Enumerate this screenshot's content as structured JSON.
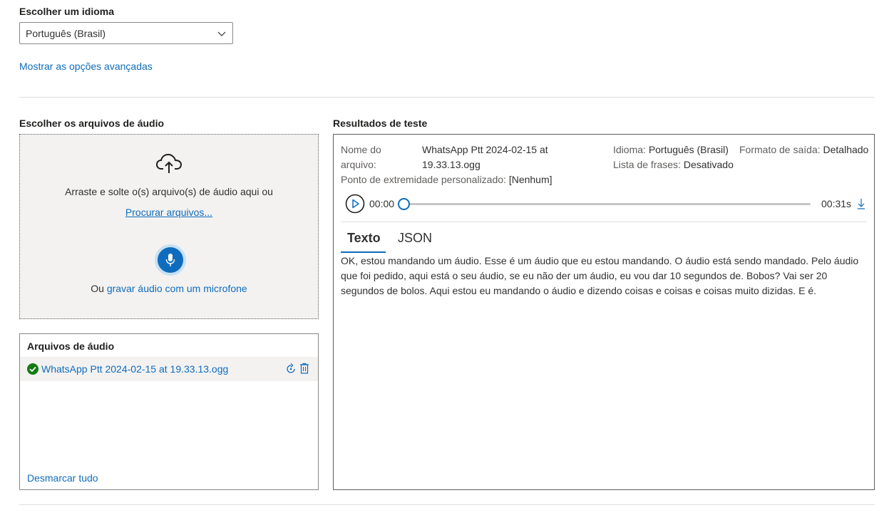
{
  "language": {
    "label": "Escolher um idioma",
    "selected": "Português (Brasil)",
    "advanced_link": "Mostrar as opções avançadas"
  },
  "upload": {
    "title": "Escolher os arquivos de áudio",
    "drop_text": "Arraste e solte o(s) arquivo(s) de áudio aqui ou",
    "browse_link": "Procurar arquivos...",
    "record_prefix": "Ou ",
    "record_link": "gravar áudio com um microfone"
  },
  "files": {
    "title": "Arquivos de áudio",
    "items": [
      {
        "name": "WhatsApp Ptt 2024-02-15 at 19.33.13.ogg",
        "status": "success"
      }
    ],
    "deselect_all": "Desmarcar tudo"
  },
  "results": {
    "title": "Resultados de teste",
    "file_name_label_1": "Nome do",
    "file_name_label_2": "arquivo:",
    "file_name_value_1": "WhatsApp Ptt 2024-02-15 at",
    "file_name_value_2": "19.33.13.ogg",
    "language_label": "Idioma:",
    "language_value": "Português (Brasil)",
    "output_format_label": "Formato de saída:",
    "output_format_value": "Detalhado",
    "phrase_list_label": "Lista de frases:",
    "phrase_list_value": "Desativado",
    "endpoint_label": "Ponto de extremidade personalizado:",
    "endpoint_value": "[Nenhum]",
    "player": {
      "current_time": "00:00",
      "duration": "00:31s",
      "progress": 0
    },
    "tabs": [
      {
        "label": "Texto",
        "active": true
      },
      {
        "label": "JSON",
        "active": false
      }
    ],
    "transcript": "OK, estou mandando um áudio. Esse é um áudio que eu estou mandando. O áudio está sendo mandado. Pelo áudio que foi pedido, aqui está o seu áudio, se eu não der um áudio, eu vou dar 10 segundos de. Bobos? Vai ser 20 segundos de bolos. Aqui estou eu mandando o áudio e dizendo coisas e coisas e coisas muito dizidas. E é."
  },
  "colors": {
    "accent": "#0f6cbd",
    "success": "#107c10"
  }
}
